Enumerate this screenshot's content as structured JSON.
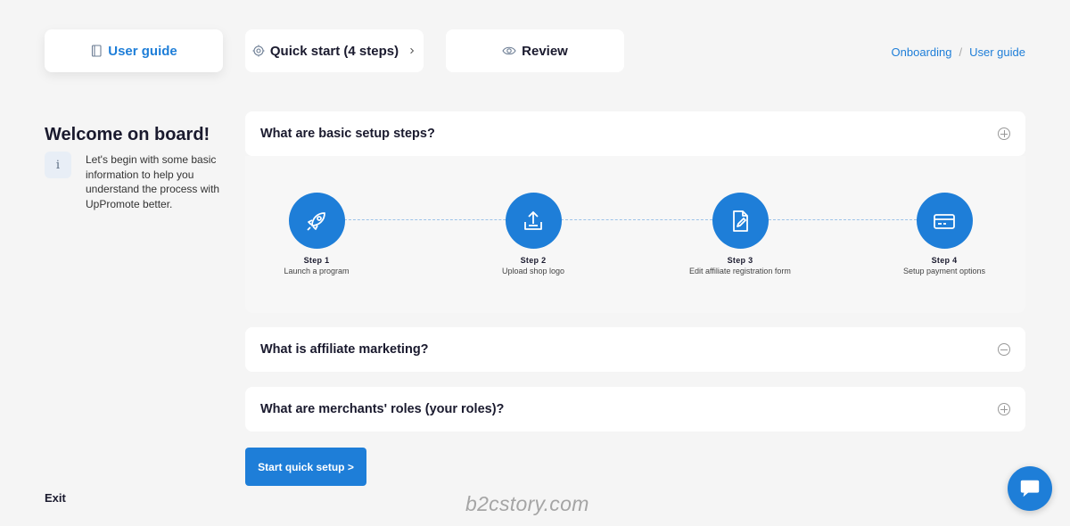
{
  "tabs": [
    {
      "label": "User guide",
      "icon": "book-icon",
      "active": true
    },
    {
      "label": "Quick start (4 steps)",
      "icon": "gear-icon",
      "trailing_icon": "chevron-right-icon"
    },
    {
      "label": "Review",
      "icon": "eye-icon"
    }
  ],
  "breadcrumb": [
    "Onboarding",
    "User guide"
  ],
  "welcome": {
    "title": "Welcome on board!",
    "icon": "info-icon",
    "text": "Let's begin with some basic information to help you understand the process with UpPromote better."
  },
  "faq": [
    {
      "question": "What are basic setup steps?",
      "expanded": true
    },
    {
      "question": "What is affiliate marketing?",
      "expanded": false
    },
    {
      "question": "What are merchants' roles (your roles)?",
      "expanded": false
    }
  ],
  "steps": [
    {
      "num": "Step 1",
      "label": "Launch a program",
      "icon": "rocket-icon"
    },
    {
      "num": "Step 2",
      "label": "Upload shop logo",
      "icon": "upload-icon"
    },
    {
      "num": "Step 3",
      "label": "Edit affiliate registration form",
      "icon": "edit-document-icon"
    },
    {
      "num": "Step 4",
      "label": "Setup payment options",
      "icon": "credit-card-icon"
    }
  ],
  "start_button": "Start quick setup >",
  "exit_label": "Exit",
  "watermark": "b2cstory.com",
  "chat_icon": "chat-bubble-icon",
  "colors": {
    "accent": "#1e7ed8",
    "background": "#f5f5f5",
    "text": "#1a1a2e"
  }
}
